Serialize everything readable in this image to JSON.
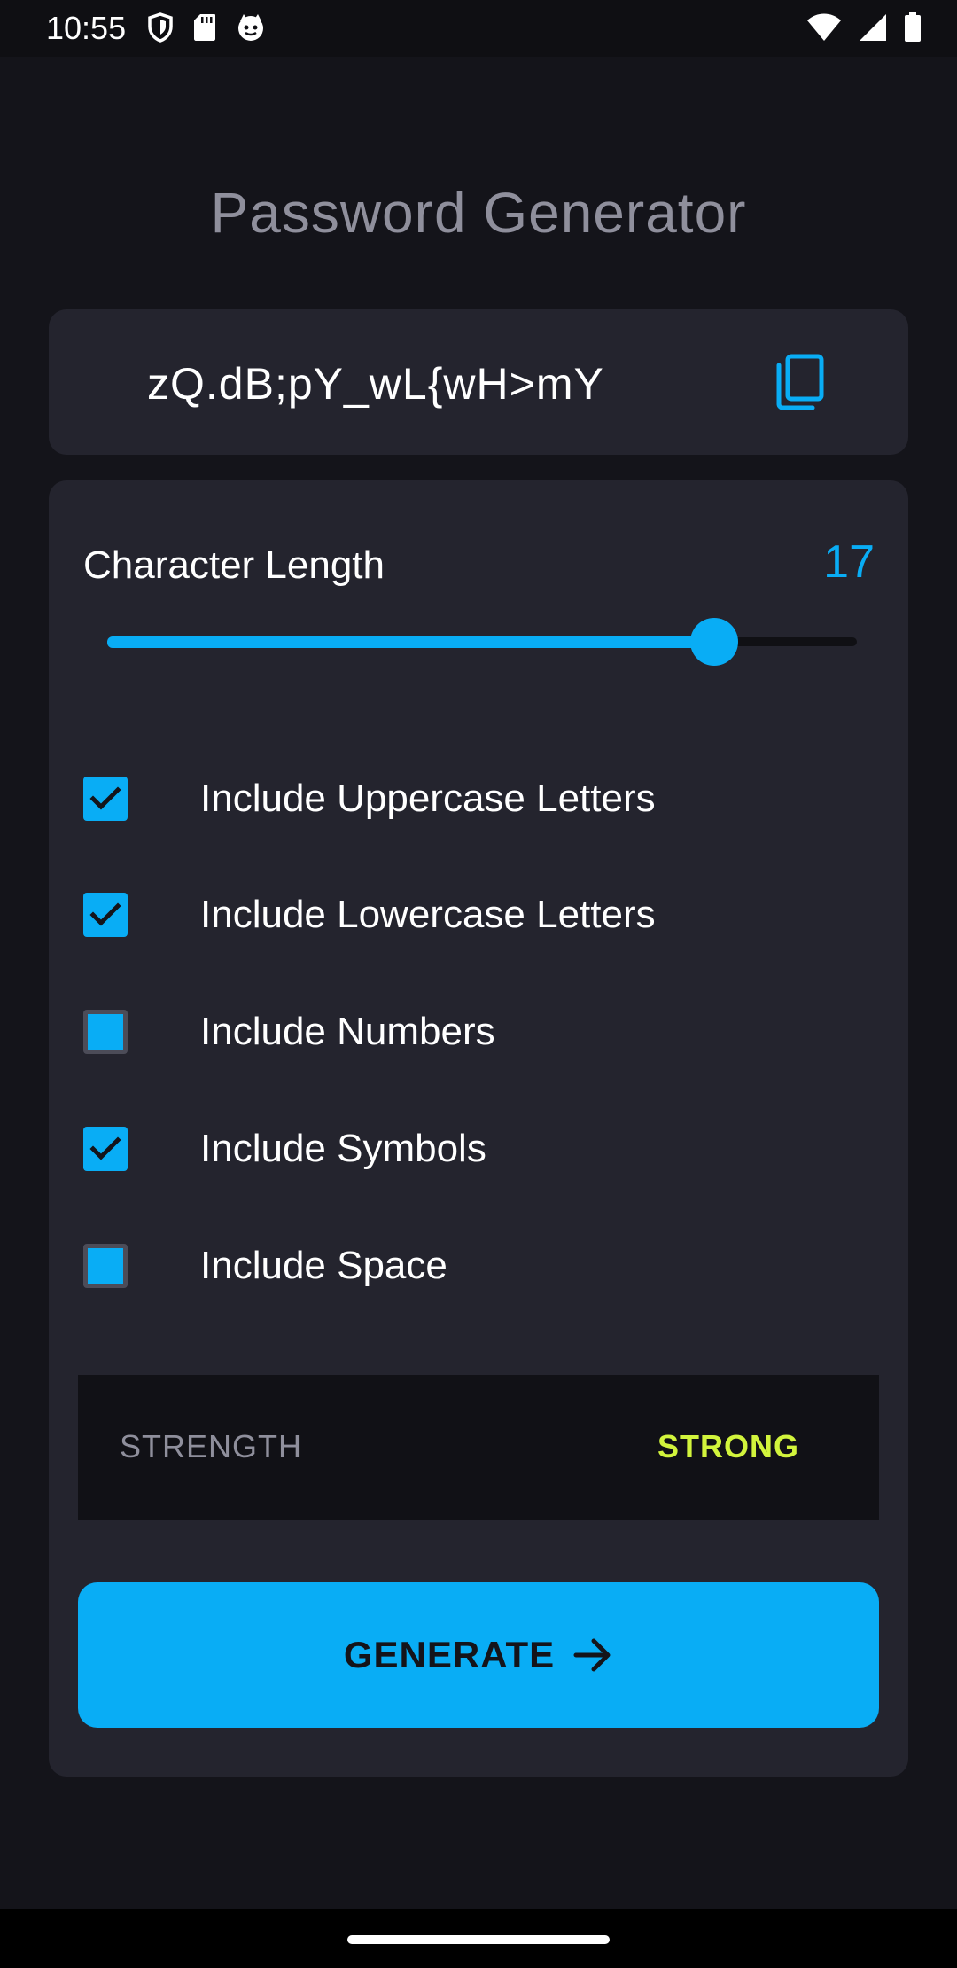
{
  "status_bar": {
    "time": "10:55",
    "icons_left": [
      "shield-icon",
      "sd-card-icon",
      "cat-icon"
    ],
    "icons_right": [
      "wifi-icon",
      "signal-icon",
      "battery-icon"
    ]
  },
  "title": "Password Generator",
  "password": {
    "value": "zQ.dB;pY_wL{wH>mY",
    "copy_icon": "copy-icon"
  },
  "length": {
    "label": "Character Length",
    "value": "17",
    "slider_fraction": 0.81
  },
  "options": [
    {
      "label": "Include Uppercase Letters",
      "checked": true
    },
    {
      "label": "Include Lowercase Letters",
      "checked": true
    },
    {
      "label": "Include Numbers",
      "checked": false
    },
    {
      "label": "Include Symbols",
      "checked": true
    },
    {
      "label": "Include Space",
      "checked": false
    }
  ],
  "strength": {
    "label": "STRENGTH",
    "value": "STRONG"
  },
  "generate_button": {
    "label": "GENERATE",
    "icon": "arrow-right-icon"
  },
  "colors": {
    "accent": "#09adf5",
    "background": "#14141a",
    "card": "#24242e",
    "strength_strong": "#d2f43c",
    "title": "#8f8f9c"
  }
}
